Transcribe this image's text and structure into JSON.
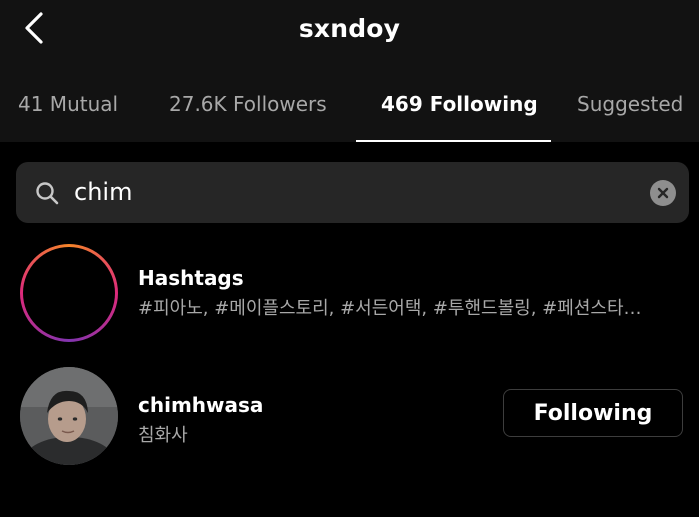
{
  "header": {
    "title": "sxndoy",
    "back_icon": "chevron-left-icon"
  },
  "tabs": [
    {
      "label": "41 Mutual",
      "active": false
    },
    {
      "label": "27.6K Followers",
      "active": false
    },
    {
      "label": "469 Following",
      "active": true
    },
    {
      "label": "Suggested",
      "active": false
    }
  ],
  "search": {
    "value": "chim",
    "search_icon": "search-icon",
    "clear_icon": "clear-icon"
  },
  "results": [
    {
      "type": "hashtags",
      "icon": "hashtag-icon",
      "title": "Hashtags",
      "subtitle": "#피아노, #메이플스토리, #서든어택, #투핸드볼링, #페션스타…"
    },
    {
      "type": "account",
      "title": "chimhwasa",
      "subtitle": "침화사",
      "button_label": "Following"
    }
  ],
  "colors": {
    "background": "#000000",
    "header_bg": "#121212",
    "search_bg": "#262626",
    "muted_text": "#a8a8a8",
    "story_ring": "#dd2a7b"
  }
}
